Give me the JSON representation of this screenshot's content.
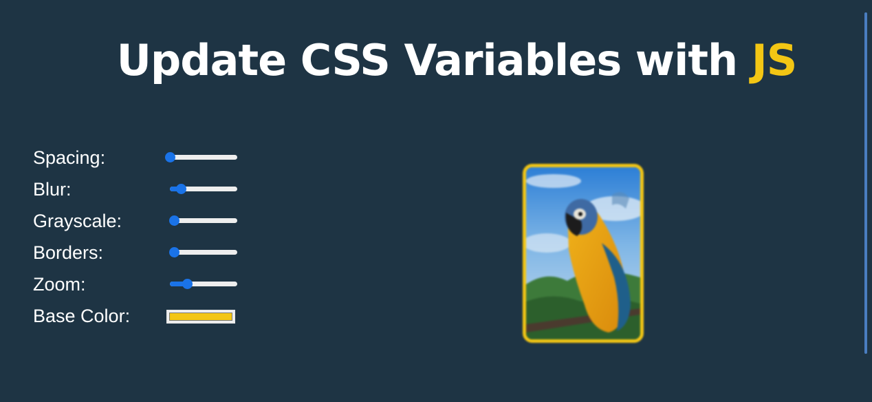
{
  "header": {
    "title_main": "Update CSS Variables with ",
    "title_accent": "JS"
  },
  "colors": {
    "background": "#1e3444",
    "accent": "#f3c614",
    "slider_active": "#1a73e8"
  },
  "controls": [
    {
      "label": "Spacing:",
      "type": "range",
      "value": 0.0
    },
    {
      "label": "Blur:",
      "type": "range",
      "value": 0.16
    },
    {
      "label": "Grayscale:",
      "type": "range",
      "value": 0.06
    },
    {
      "label": "Borders:",
      "type": "range",
      "value": 0.06
    },
    {
      "label": "Zoom:",
      "type": "range",
      "value": 0.25
    },
    {
      "label": "Base Color:",
      "type": "color",
      "value": "#f3c614"
    }
  ],
  "image": {
    "subject": "parrot-photo"
  }
}
